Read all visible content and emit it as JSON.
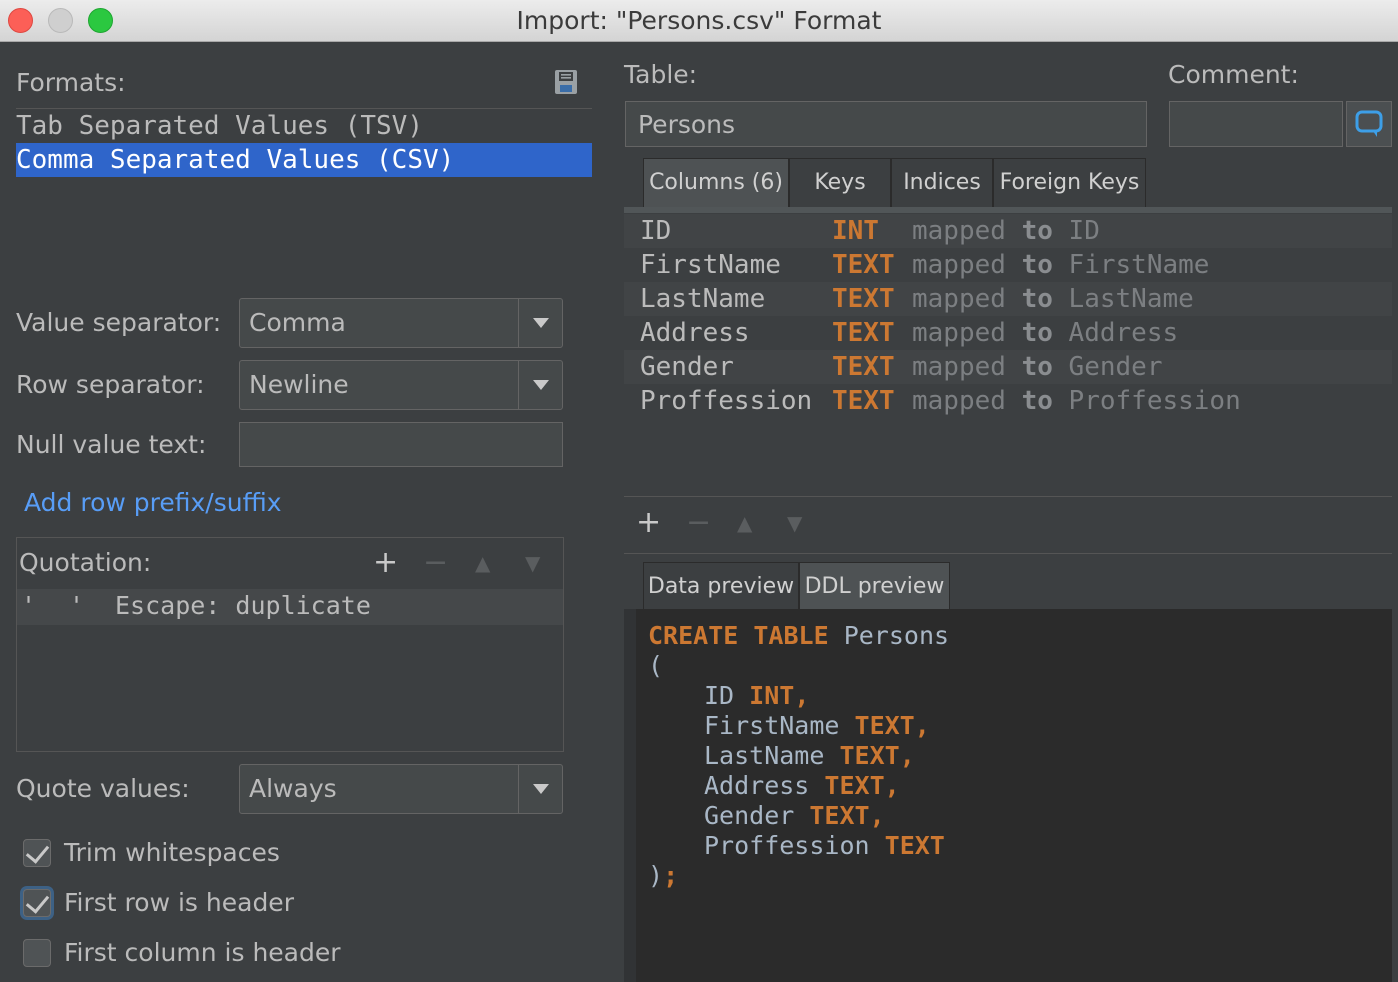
{
  "window": {
    "title": "Import: \"Persons.csv\" Format"
  },
  "formats": {
    "label": "Formats:",
    "save_icon": "save-icon",
    "items": [
      "Tab Separated Values (TSV)",
      "Comma Separated Values (CSV)"
    ],
    "selected_index": 1
  },
  "settings": {
    "value_separator": {
      "label": "Value separator:",
      "value": "Comma"
    },
    "row_separator": {
      "label": "Row separator:",
      "value": "Newline"
    },
    "null_value_text": {
      "label": "Null value text:",
      "value": ""
    },
    "add_prefix_link": "Add row prefix/suffix"
  },
  "quotation": {
    "label": "Quotation:",
    "rows": [
      {
        "open": "'",
        "close": "'",
        "escape": "Escape: duplicate"
      }
    ]
  },
  "quote_values": {
    "label": "Quote values:",
    "value": "Always"
  },
  "checkboxes": [
    {
      "label": "Trim whitespaces",
      "checked": true
    },
    {
      "label": "First row is header",
      "checked": true
    },
    {
      "label": "First column is header",
      "checked": false
    }
  ],
  "table": {
    "label": "Table:",
    "value": "Persons"
  },
  "comment": {
    "label": "Comment:",
    "value": ""
  },
  "tabs": [
    "Columns (6)",
    "Keys",
    "Indices",
    "Foreign Keys"
  ],
  "columns": [
    {
      "name": "ID",
      "type": "INT",
      "mapped": "mapped",
      "to": "to",
      "target": "ID"
    },
    {
      "name": "FirstName",
      "type": "TEXT",
      "mapped": "mapped",
      "to": "to",
      "target": "FirstName"
    },
    {
      "name": "LastName",
      "type": "TEXT",
      "mapped": "mapped",
      "to": "to",
      "target": "LastName"
    },
    {
      "name": "Address",
      "type": "TEXT",
      "mapped": "mapped",
      "to": "to",
      "target": "Address"
    },
    {
      "name": "Gender",
      "type": "TEXT",
      "mapped": "mapped",
      "to": "to",
      "target": "Gender"
    },
    {
      "name": "Proffession",
      "type": "TEXT",
      "mapped": "mapped",
      "to": "to",
      "target": "Proffession"
    }
  ],
  "preview_tabs": [
    "Data preview",
    "DDL preview"
  ],
  "ddl": {
    "create": "CREATE",
    "table_kw": "TABLE",
    "table_name": "Persons",
    "open": "(",
    "lines": [
      {
        "name": "ID",
        "type": "INT",
        "sep": ","
      },
      {
        "name": "FirstName",
        "type": "TEXT",
        "sep": ","
      },
      {
        "name": "LastName",
        "type": "TEXT",
        "sep": ","
      },
      {
        "name": "Address",
        "type": "TEXT",
        "sep": ","
      },
      {
        "name": "Gender",
        "type": "TEXT",
        "sep": ","
      },
      {
        "name": "Proffession",
        "type": "TEXT",
        "sep": ""
      }
    ],
    "close": ")",
    "end": ";"
  },
  "colors": {
    "accent": "#2f65ca",
    "keyword": "#cc7832",
    "link": "#589df6",
    "background": "#3c3f41"
  }
}
